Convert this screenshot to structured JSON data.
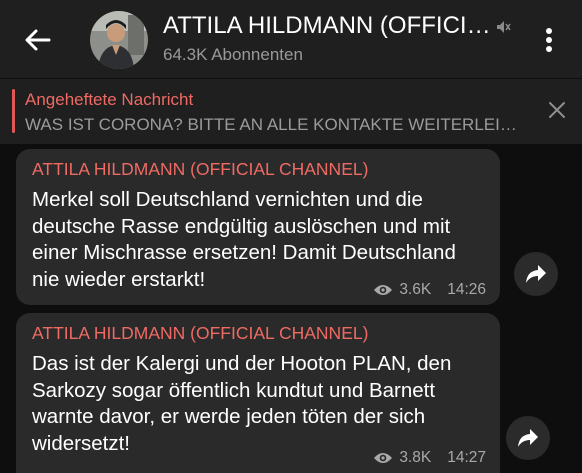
{
  "header": {
    "back_icon": "arrow-left-icon",
    "title": "ATTILA HILDMANN (OFFICIAL CHANNEL)",
    "subscribers": "64.3K Abonnenten",
    "mute_icon": "muted-speaker-icon",
    "menu_icon": "three-dots-vertical-icon"
  },
  "pinned": {
    "title": "Angeheftete Nachricht",
    "text": "WAS IST CORONA? BITTE AN ALLE KONTAKTE WEITERLEITEN",
    "close_icon": "close-icon"
  },
  "messages": [
    {
      "sender": "ATTILA HILDMANN (OFFICIAL CHANNEL)",
      "text": "Merkel soll Deutschland vernichten und die deutsche Rasse endgültig auslöschen und mit einer Mischrasse ersetzen! Damit Deutschland nie wieder erstarkt!",
      "views": "3.6K",
      "time": "14:26"
    },
    {
      "sender": "ATTILA HILDMANN (OFFICIAL CHANNEL)",
      "text": "Das ist der Kalergi und der Hooton PLAN, den Sarkozy sogar öffentlich kundtut und Barnett warnte davor, er werde jeden töten der sich widersetzt!",
      "views": "3.8K",
      "time": "14:27"
    }
  ],
  "colors": {
    "background": "#0e0e0e",
    "header": "#1f1f1f",
    "bubble": "#2a2a2a",
    "accent": "#ef6a63"
  }
}
